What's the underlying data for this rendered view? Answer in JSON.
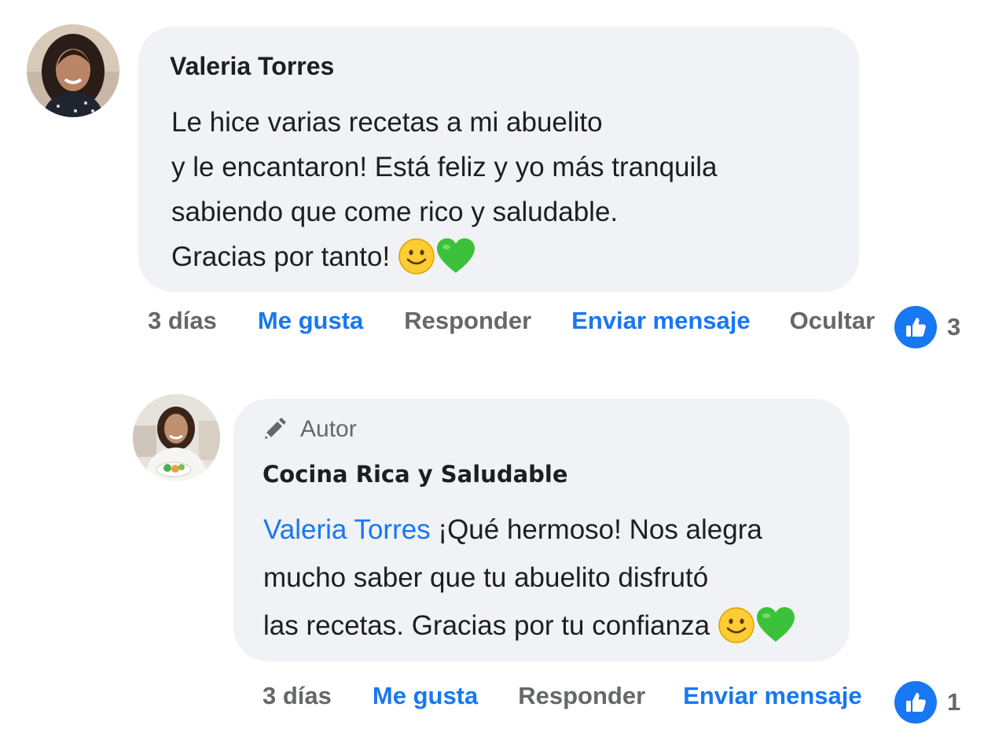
{
  "comments": [
    {
      "author": "Valeria Torres",
      "text_lines": [
        "Le hice varias recetas a mi abuelito",
        "y le encantaron! Está feliz y yo más tranquila",
        "sabiendo que come rico y saludable.",
        "Gracias por tanto!"
      ],
      "emojis": [
        "smiling-face",
        "green-heart"
      ],
      "actions": {
        "time": "3 días",
        "like": "Me gusta",
        "reply": "Responder",
        "message": "Enviar mensaje",
        "hide": "Ocultar"
      },
      "like_count": "3"
    },
    {
      "badge": "Autor",
      "author": "Cocina Rica y Saludable",
      "mention": "Valeria Torres",
      "text_lines": [
        "¡Qué hermoso! Nos alegra",
        "mucho saber que tu abuelito disfrutó",
        "las recetas. Gracias por tu confianza"
      ],
      "emojis": [
        "smiling-face",
        "green-heart"
      ],
      "actions": {
        "time": "3 días",
        "like": "Me gusta",
        "reply": "Responder",
        "message": "Enviar mensaje"
      },
      "like_count": "1"
    }
  ],
  "colors": {
    "link_blue": "#1877f2",
    "muted_grey": "#65676b",
    "bubble_bg": "#f0f2f5"
  }
}
